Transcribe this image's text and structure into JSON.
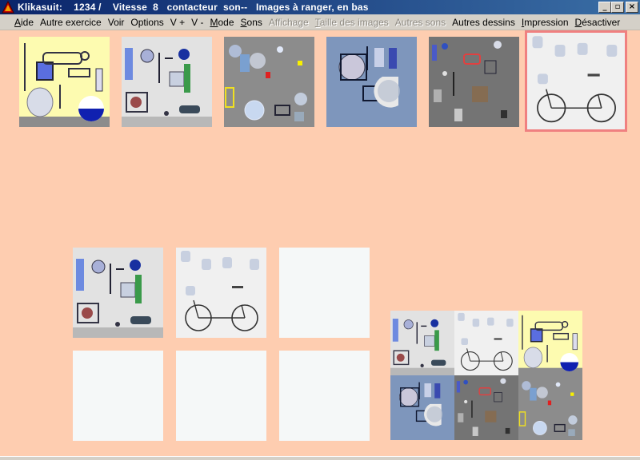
{
  "window": {
    "title": "Klikasuit:    1234 /    Vitesse  8   contacteur  son--   Images à ranger, en bas",
    "buttons": {
      "minimize": "_",
      "maximize": "▫",
      "close": "×"
    }
  },
  "menu": [
    {
      "label": "Aide",
      "u": "A",
      "rest": "ide",
      "enabled": true
    },
    {
      "label": "Autre exercice",
      "u": "",
      "rest": "Autre exercice",
      "enabled": true
    },
    {
      "label": "Voir",
      "u": "",
      "rest": "Voir",
      "enabled": true
    },
    {
      "label": "Options",
      "u": "",
      "rest": "Options",
      "enabled": true
    },
    {
      "label": "V +",
      "u": "",
      "rest": "V +",
      "enabled": true
    },
    {
      "label": "V -",
      "u": "",
      "rest": "V -",
      "enabled": true
    },
    {
      "label": "Mode",
      "u": "M",
      "rest": "ode",
      "enabled": true
    },
    {
      "label": "Sons",
      "u": "S",
      "rest": "ons",
      "enabled": true
    },
    {
      "label": "Affichage",
      "u": "",
      "rest": "Affichage",
      "enabled": false
    },
    {
      "label": "Taille des images",
      "u": "T",
      "rest": "aille des images",
      "enabled": false
    },
    {
      "label": "Autres sons",
      "u": "",
      "rest": "Autres sons",
      "enabled": false
    },
    {
      "label": "Autres dessins",
      "u": "",
      "rest": "Autres dessins",
      "enabled": true
    },
    {
      "label": "Impression",
      "u": "I",
      "rest": "mpression",
      "enabled": true
    },
    {
      "label": "Désactiver",
      "u": "D",
      "rest": "ésactiver",
      "enabled": true
    }
  ],
  "colors": {
    "background": "#fecdb0",
    "selection_border": "#f08080",
    "slot_blank": "#f5f8f8"
  },
  "thumbnails": [
    {
      "id": "yellow-shapes",
      "selected": false
    },
    {
      "id": "grey-shapes",
      "selected": false
    },
    {
      "id": "bubbles",
      "selected": false
    },
    {
      "id": "blue-shapes",
      "selected": false
    },
    {
      "id": "dark-grey-shapes",
      "selected": false
    },
    {
      "id": "bicycle",
      "selected": true
    }
  ],
  "answer_slots": [
    {
      "content": "grey-shapes"
    },
    {
      "content": "bicycle"
    },
    {
      "content": "empty"
    },
    {
      "content": "empty"
    },
    {
      "content": "empty"
    },
    {
      "content": "empty"
    }
  ],
  "model_cells": [
    "grey-shapes",
    "bicycle",
    "yellow-shapes",
    "blue-shapes",
    "dark-grey-shapes",
    "bubbles"
  ]
}
